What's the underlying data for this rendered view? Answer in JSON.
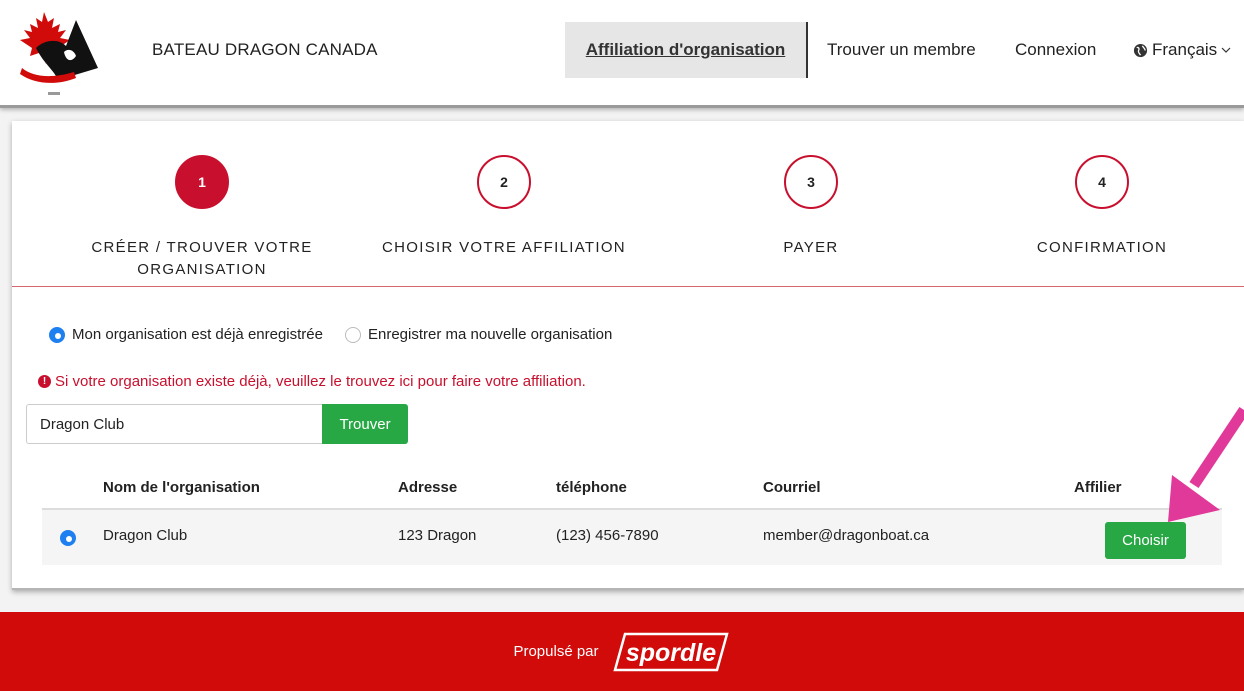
{
  "header": {
    "brand": "BATEAU DRAGON CANADA",
    "nav": {
      "affiliation": "Affiliation d'organisation",
      "find_member": "Trouver un membre",
      "login": "Connexion",
      "language": "Français"
    }
  },
  "steps": [
    {
      "number": "1",
      "label": "CRÉER / TROUVER VOTRE ORGANISATION",
      "active": true
    },
    {
      "number": "2",
      "label": "CHOISIR VOTRE AFFILIATION",
      "active": false
    },
    {
      "number": "3",
      "label": "PAYER",
      "active": false
    },
    {
      "number": "4",
      "label": "CONFIRMATION",
      "active": false
    }
  ],
  "options": {
    "existing": "Mon organisation est déjà enregistrée",
    "new": "Enregistrer ma nouvelle organisation"
  },
  "notice": "Si votre organisation existe déjà, veuillez le trouvez ici pour faire votre affiliation.",
  "search": {
    "value": "Dragon Club",
    "button": "Trouver"
  },
  "table": {
    "headers": {
      "name": "Nom de l'organisation",
      "address": "Adresse",
      "phone": "téléphone",
      "email": "Courriel",
      "affiliate": "Affilier"
    },
    "rows": [
      {
        "name": "Dragon Club",
        "address": "123 Dragon",
        "phone": "(123) 456-7890",
        "email": "member@dragonboat.ca",
        "button": "Choisir"
      }
    ]
  },
  "footer": {
    "powered_by": "Propulsé par",
    "brand": "spordle"
  },
  "colors": {
    "brand_red": "#c8102e",
    "success_green": "#28a745",
    "radio_blue": "#1e80f0",
    "arrow_pink": "#e0399a",
    "footer_red": "#d10a0a"
  }
}
